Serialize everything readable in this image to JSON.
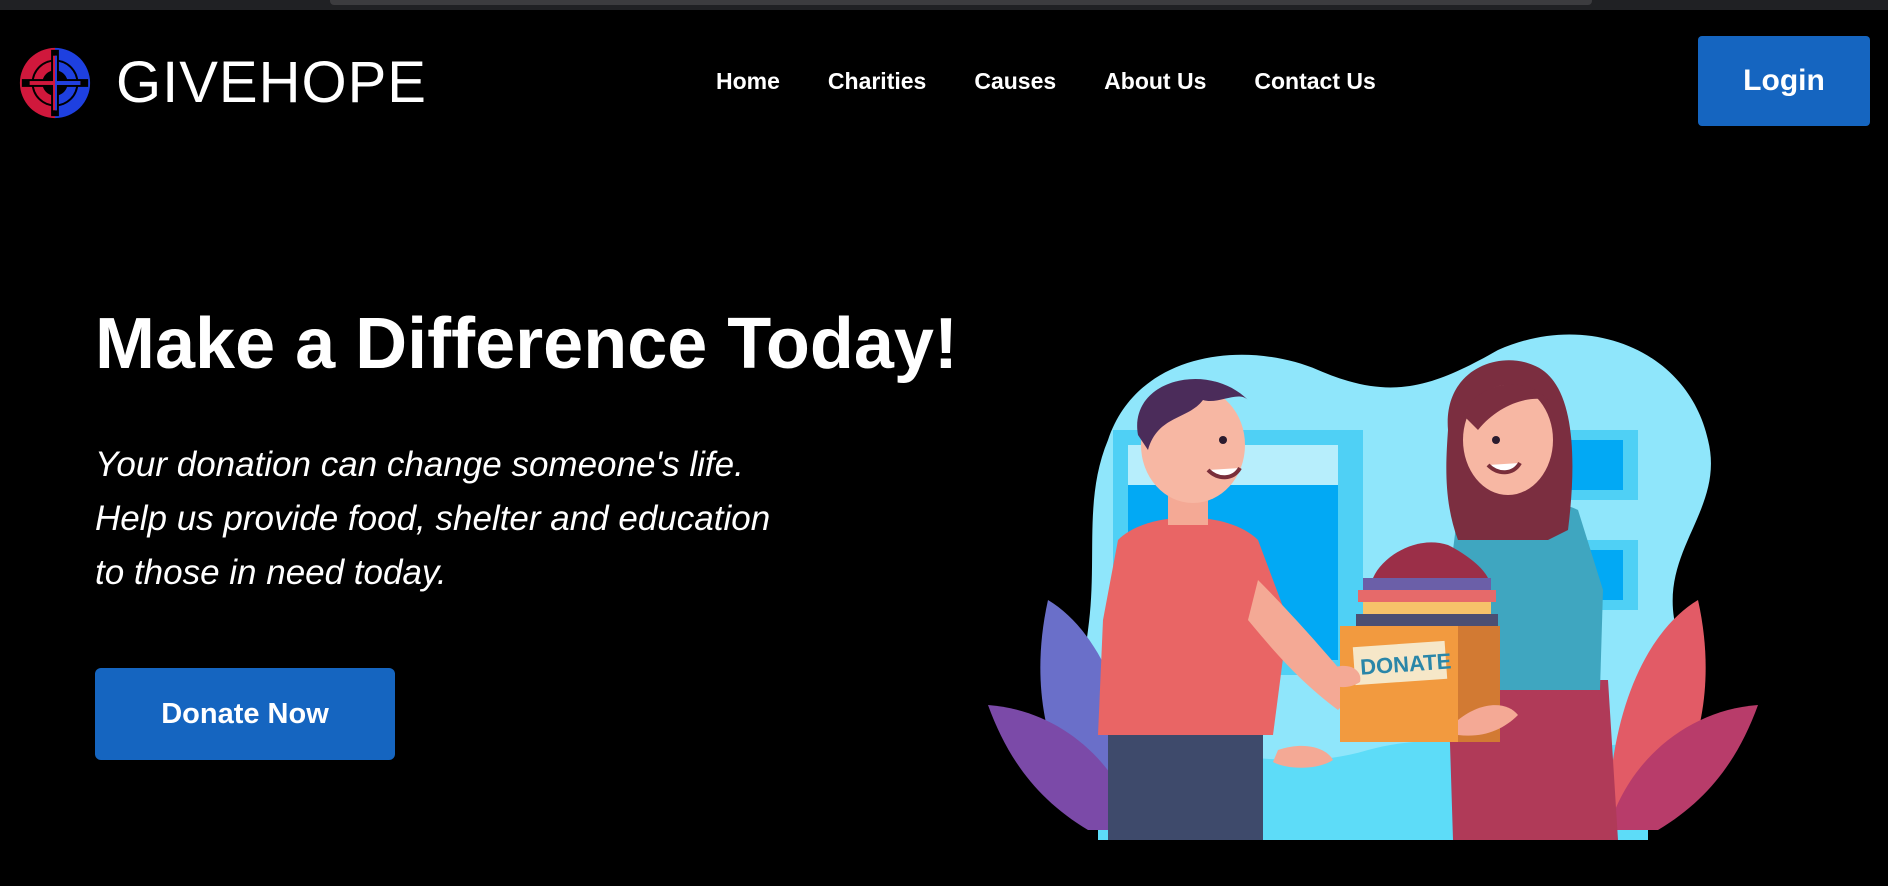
{
  "brand": {
    "name": "GIVEHOPE",
    "logo_icon": "givehope-logo-icon"
  },
  "nav": {
    "links": [
      {
        "label": "Home"
      },
      {
        "label": "Charities"
      },
      {
        "label": "Causes"
      },
      {
        "label": "About Us"
      },
      {
        "label": "Contact Us"
      }
    ],
    "login_label": "Login"
  },
  "hero": {
    "title": "Make a Difference Today!",
    "subtitle_lines": [
      "Your donation can change someone's life.",
      "Help us provide food, shelter and education",
      "to those in need today."
    ],
    "cta_label": "Donate Now",
    "illustration": {
      "box_label": "DONATE"
    }
  },
  "colors": {
    "background": "#000000",
    "accent": "#1565c0",
    "logo_red": "#d0183c",
    "logo_blue": "#1e40e0"
  }
}
